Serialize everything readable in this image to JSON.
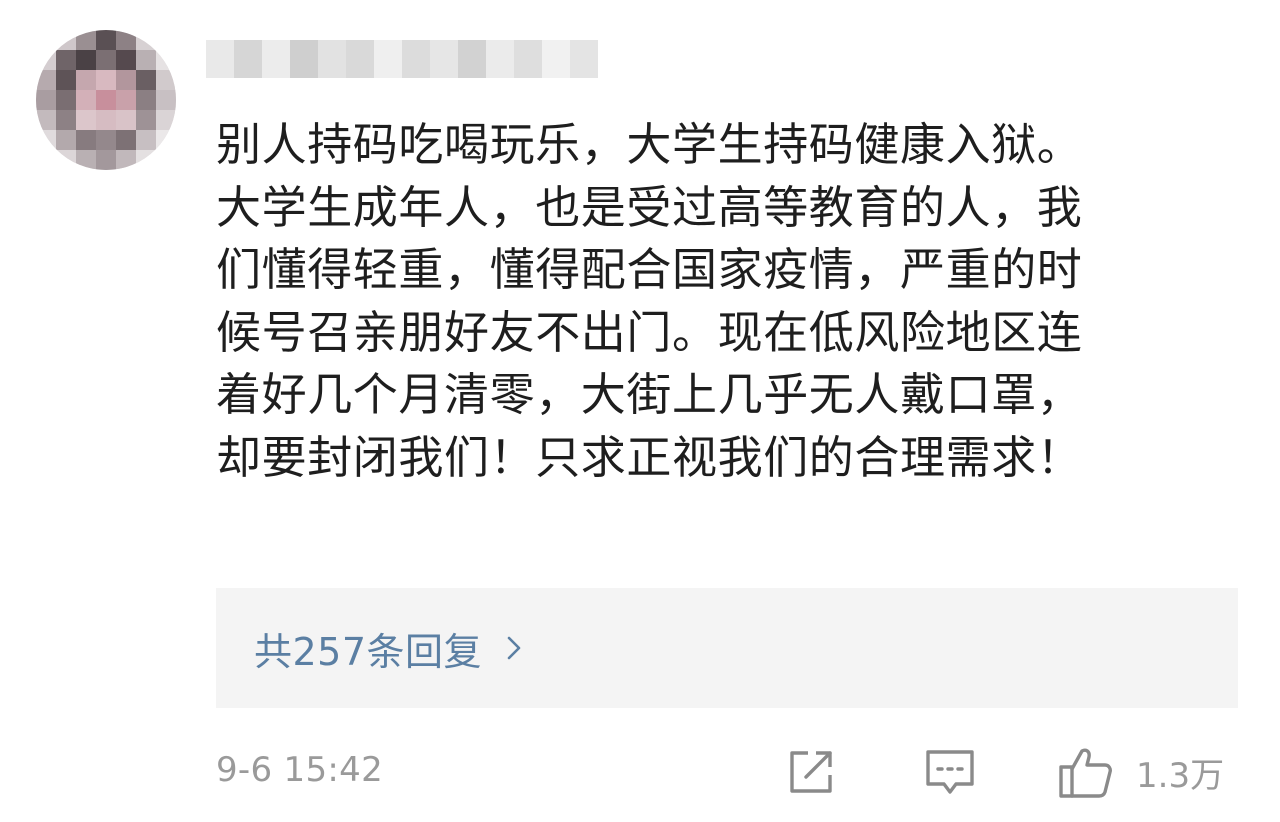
{
  "comment": {
    "lines": [
      "别人持码吃喝玩乐，大学生持码健康入狱。",
      "大学生成年人，也是受过高等教育的人，我",
      "们懂得轻重，懂得配合国家疫情，严重的时",
      "候号召亲朋好友不出门。现在低风险地区连",
      "着好几个月清零，大街上几乎无人戴口罩，",
      "却要封闭我们！只求正视我们的合理需求！"
    ]
  },
  "replies": {
    "label": "共257条回复"
  },
  "footer": {
    "timestamp": "9-6 15:42",
    "like_count": "1.3万"
  },
  "icons": {
    "share": "share-icon",
    "comment": "comment-icon",
    "like": "thumbs-up-icon",
    "chevron": "chevron-right-icon"
  },
  "colors": {
    "body_text": "#1e1e1e",
    "link_text": "#5b7fa3",
    "meta_text": "#9a9a9a",
    "reply_bg": "#f4f4f4",
    "icon_gray": "#8a8a8a"
  }
}
